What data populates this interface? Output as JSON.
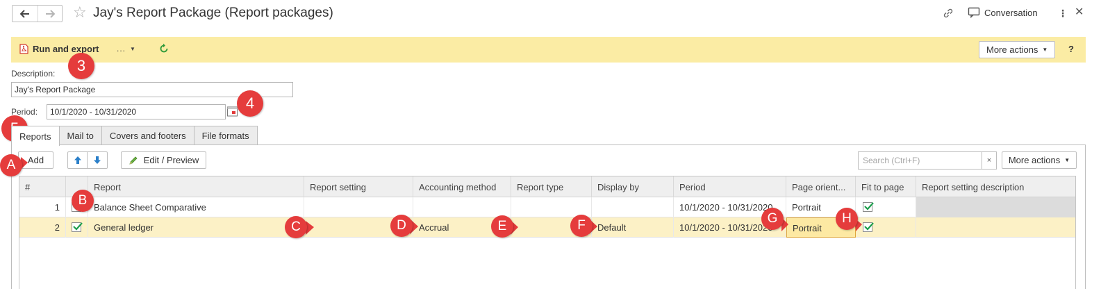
{
  "window": {
    "title": "Jay's Report Package (Report packages)",
    "conversation_label": "Conversation"
  },
  "commandbar": {
    "run_label": "Run and export",
    "dots_label": "...",
    "more_actions_label": "More actions",
    "help_label": "?"
  },
  "form": {
    "description_label": "Description:",
    "description_value": "Jay's Report Package",
    "period_label": "Period:",
    "period_value": "10/1/2020 - 10/31/2020"
  },
  "tabs": [
    {
      "label": "Reports",
      "active": true
    },
    {
      "label": "Mail to",
      "active": false
    },
    {
      "label": "Covers and footers",
      "active": false
    },
    {
      "label": "File formats",
      "active": false
    }
  ],
  "toolbar": {
    "add_label": "Add",
    "edit_preview_label": "Edit / Preview",
    "search_placeholder": "Search (Ctrl+F)",
    "search_clear": "×",
    "more_actions_label": "More actions"
  },
  "table": {
    "columns": [
      "#",
      "",
      "Report",
      "Report setting",
      "Accounting method",
      "Report type",
      "Display by",
      "Period",
      "Page orient...",
      "Fit to page",
      "Report setting description"
    ],
    "rows": [
      {
        "num": "1",
        "checked": true,
        "report": "Balance Sheet Comparative",
        "report_setting": "",
        "accounting_method": "",
        "report_type": "",
        "display_by": "",
        "period": "10/1/2020 - 10/31/2020",
        "page_orientation": "Portrait",
        "fit_to_page": true,
        "description": ""
      },
      {
        "num": "2",
        "checked": true,
        "report": "General ledger",
        "report_setting": "",
        "accounting_method": "Accrual",
        "report_type": "",
        "display_by": "Default",
        "period": "10/1/2020 - 10/31/2020",
        "page_orientation": "Portrait",
        "fit_to_page": true,
        "description": ""
      }
    ]
  },
  "callouts": [
    "3",
    "4",
    "5",
    "A",
    "B",
    "C",
    "D",
    "E",
    "F",
    "G",
    "H"
  ],
  "colors": {
    "command_bar_bg": "#fbeca4",
    "selected_row_bg": "#fcf1c6",
    "callout_red": "#e53c3c",
    "accent_blue": "#2a7fc9",
    "check_green": "#1d9e4d"
  }
}
